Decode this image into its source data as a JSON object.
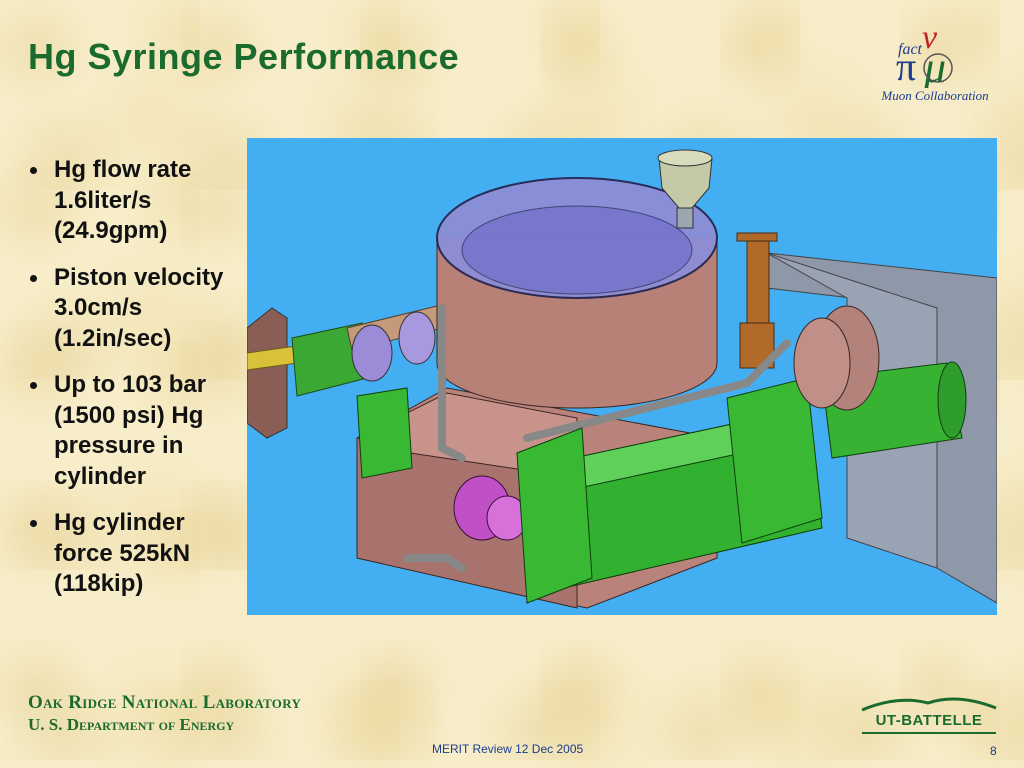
{
  "slide": {
    "title": "Hg Syringe Performance",
    "bullets": [
      "Hg flow rate 1.6liter/s (24.9gpm)",
      "Piston velocity 3.0cm/s (1.2in/sec)",
      "Up to 103 bar (1500 psi) Hg pressure in cylinder",
      "Hg cylinder force 525kN (118kip)"
    ]
  },
  "logo": {
    "lettering": "fact νμ",
    "caption": "Muon Collaboration"
  },
  "footer": {
    "org_line1": "Oak Ridge National Laboratory",
    "org_line2": "U. S. Department of Energy",
    "meeting": "MERIT Review 12 Dec 2005",
    "page_number": "8",
    "partner_logo": "UT-BATTELLE"
  },
  "colors": {
    "title": "#1b6b2e",
    "figure_background": "#43aef2",
    "footer_text": "#1b3d8f"
  }
}
